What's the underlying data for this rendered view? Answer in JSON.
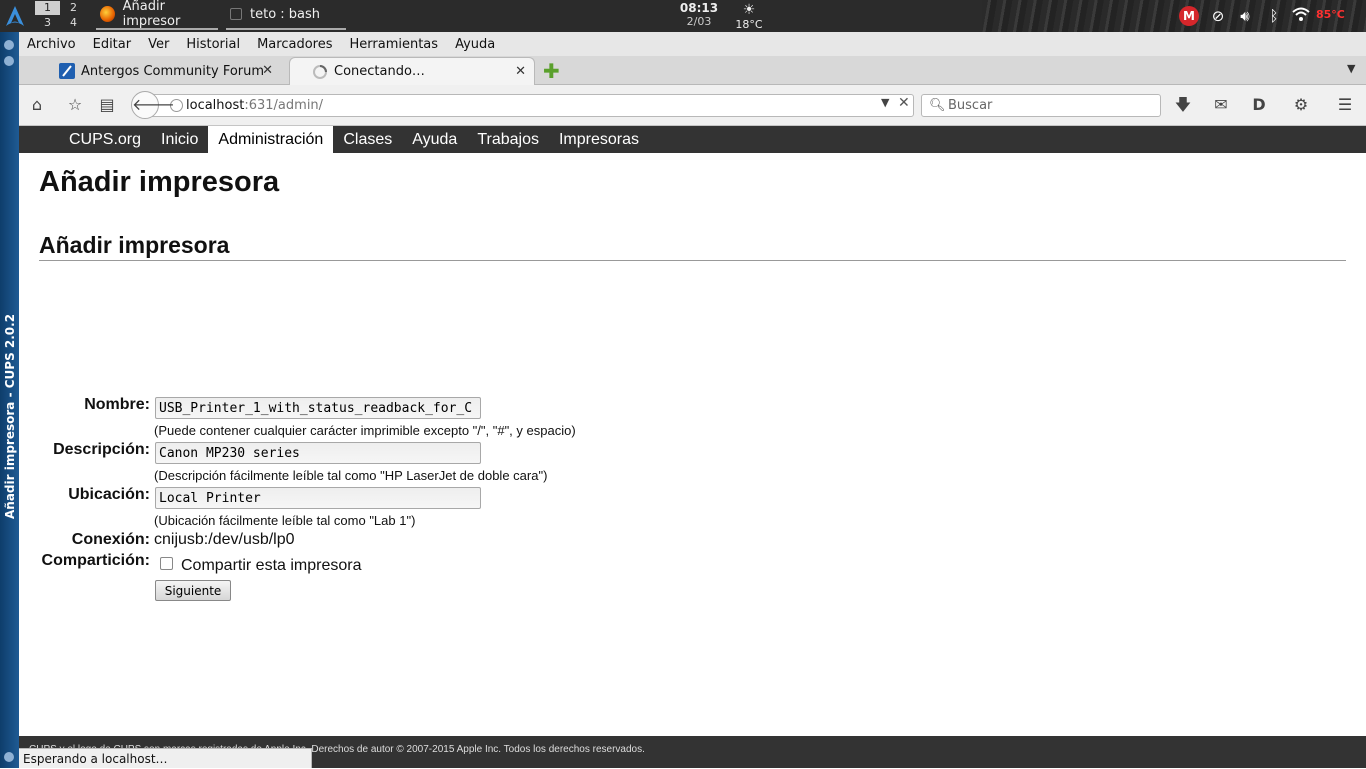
{
  "desktop": {
    "workspaces": [
      "1",
      "2",
      "3",
      "4"
    ],
    "active_workspace": "1",
    "tasks": [
      {
        "label": "Añadir impresor"
      },
      {
        "label": "teto : bash"
      }
    ],
    "clock": {
      "time": "08:13",
      "date": "2/03"
    },
    "weather": {
      "temp": "18°C"
    },
    "tray": {
      "mega_label": "M",
      "cpu_temp": "85°C",
      "temp_color": "#ff3030"
    },
    "side_title": "Añadir impresora - CUPS 2.0.2"
  },
  "browser": {
    "menu": [
      "Archivo",
      "Editar",
      "Ver",
      "Historial",
      "Marcadores",
      "Herramientas",
      "Ayuda"
    ],
    "tabs": [
      {
        "label": "Antergos Community Forum",
        "active": false
      },
      {
        "label": "Conectando…",
        "active": true
      }
    ],
    "url": {
      "host": "localhost",
      "path": ":631/admin/"
    },
    "search": {
      "placeholder": "Buscar"
    },
    "status": "Esperando a localhost…"
  },
  "cups": {
    "nav": [
      "CUPS.org",
      "Inicio",
      "Administración",
      "Clases",
      "Ayuda",
      "Trabajos",
      "Impresoras"
    ],
    "active_nav": "Administración",
    "title": "Añadir impresora",
    "section_title": "Añadir impresora",
    "form": {
      "name_label": "Nombre:",
      "name_value": "USB_Printer_1_with_status_readback_for_C",
      "name_help": "(Puede contener cualquier carácter imprimible excepto \"/\", \"#\", y espacio)",
      "desc_label": "Descripción:",
      "desc_value": "Canon MP230 series",
      "desc_help": "(Descripción fácilmente leíble tal como \"HP LaserJet de doble cara\")",
      "loc_label": "Ubicación:",
      "loc_value": "Local Printer",
      "loc_help": "(Ubicación fácilmente leíble tal como \"Lab 1\")",
      "conn_label": "Conexión:",
      "conn_value": "cnijusb:/dev/usb/lp0",
      "share_label": "Compartición:",
      "share_text": "Compartir esta impresora",
      "share_checked": false,
      "next_label": "Siguiente"
    },
    "footer": "CUPS y el logo de CUPS son marcas registradas de Apple Inc. Derechos de autor © 2007-2015 Apple Inc. Todos los derechos reservados."
  },
  "colors": {
    "cups_nav_bg": "#333333",
    "left_panel": "#1f5b94",
    "add_tab_green": "#5aa02c"
  }
}
